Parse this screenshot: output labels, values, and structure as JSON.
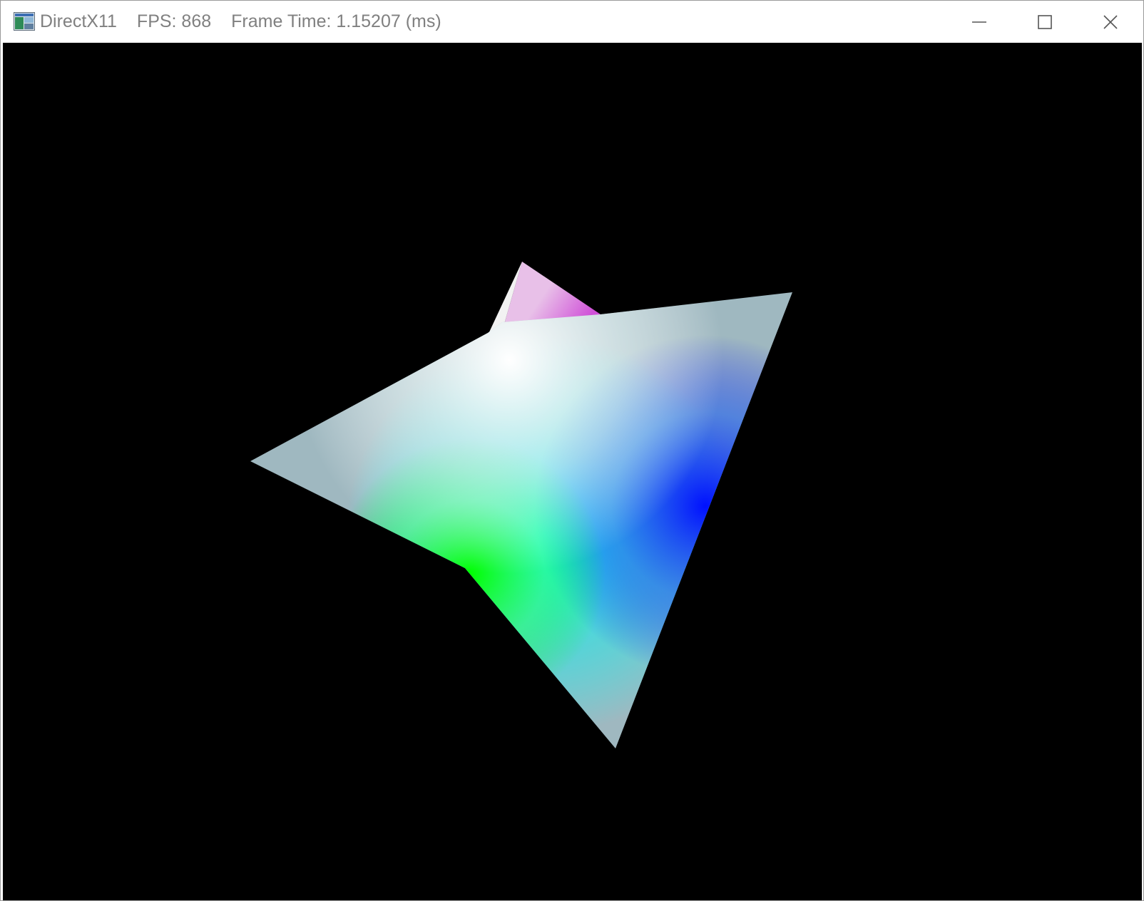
{
  "window": {
    "app_name": "DirectX11",
    "fps_text": "FPS: 868",
    "frame_time_text": "Frame Time: 1.15207 (ms)"
  },
  "icons": {
    "app": "directx-app-icon",
    "minimize": "minimize-icon",
    "maximize": "maximize-icon",
    "close": "close-icon"
  },
  "scene": {
    "background_color": "#000000",
    "object": "rotating shaded tetrahedron",
    "face_colors": [
      "#ffffff",
      "#00ffff",
      "#00ff00",
      "#0000ff",
      "#e070e0"
    ]
  }
}
